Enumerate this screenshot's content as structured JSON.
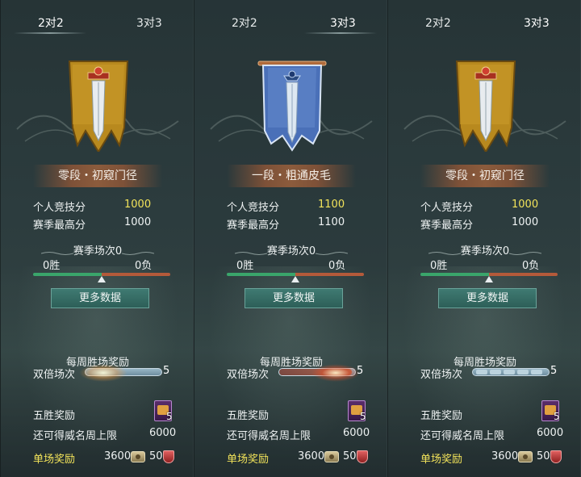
{
  "panels": [
    {
      "tabs": [
        "2对2",
        "3对3"
      ],
      "active_tab": 0,
      "emblem": "gold-sword-banner",
      "rank_title": "零段・初窥门径",
      "personal_score_label": "个人竞技分",
      "personal_score_value": "1000",
      "season_high_label": "赛季最高分",
      "season_high_value": "1000",
      "season_matches": "赛季场次0",
      "wins": "0胜",
      "losses": "0负",
      "more_button": "更多数据",
      "weekly_title": "每周胜场奖励",
      "double_label": "双倍场次",
      "double_count": "5",
      "five_win_label": "五胜奖励",
      "five_win_count": "5",
      "limit_label": "还可得威名周上限",
      "limit_value": "6000",
      "single_label": "单场奖励",
      "single_value1": "3600",
      "single_value2": "50"
    },
    {
      "tabs": [
        "2对2",
        "3对3"
      ],
      "active_tab": 1,
      "emblem": "silver-sword-banner",
      "rank_title": "一段・粗通皮毛",
      "personal_score_label": "个人竞技分",
      "personal_score_value": "1100",
      "season_high_label": "赛季最高分",
      "season_high_value": "1100",
      "season_matches": "赛季场次0",
      "wins": "0胜",
      "losses": "0负",
      "more_button": "更多数据",
      "weekly_title": "每周胜场奖励",
      "double_label": "双倍场次",
      "double_count": "5",
      "five_win_label": "五胜奖励",
      "five_win_count": "5",
      "limit_label": "还可得威名周上限",
      "limit_value": "6000",
      "single_label": "单场奖励",
      "single_value1": "3600",
      "single_value2": "50"
    },
    {
      "tabs": [
        "2对2",
        "3对3"
      ],
      "active_tab": 1,
      "emblem": "gold-sword-banner",
      "rank_title": "零段・初窥门径",
      "personal_score_label": "个人竞技分",
      "personal_score_value": "1000",
      "season_high_label": "赛季最高分",
      "season_high_value": "1000",
      "season_matches": "赛季场次0",
      "wins": "0胜",
      "losses": "0负",
      "more_button": "更多数据",
      "weekly_title": "每周胜场奖励",
      "double_label": "双倍场次",
      "double_count": "5",
      "five_win_label": "五胜奖励",
      "five_win_count": "5",
      "limit_label": "还可得威名周上限",
      "limit_value": "6000",
      "single_label": "单场奖励",
      "single_value1": "3600",
      "single_value2": "50"
    }
  ],
  "colors": {
    "gold_text": "#f2e35a",
    "win_bar": "#3aa56b",
    "loss_bar": "#b45a3a",
    "button": "#3f7a72"
  }
}
